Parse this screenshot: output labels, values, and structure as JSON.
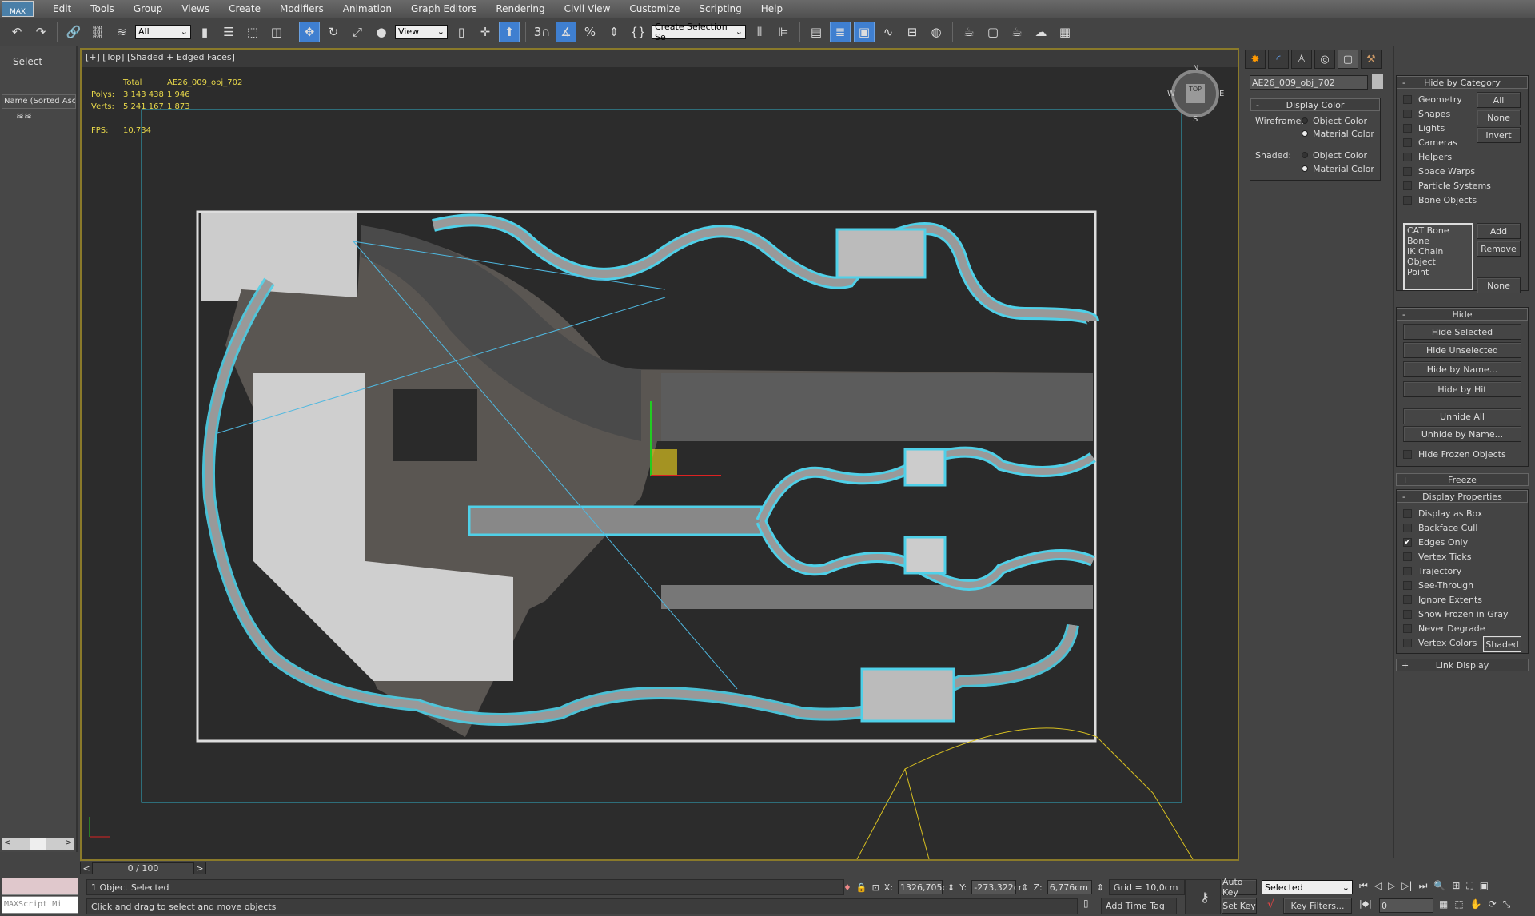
{
  "app": {
    "logo": "MAX"
  },
  "menu": [
    "Edit",
    "Tools",
    "Group",
    "Views",
    "Create",
    "Modifiers",
    "Animation",
    "Graph Editors",
    "Rendering",
    "Civil View",
    "Customize",
    "Scripting",
    "Help"
  ],
  "toolbar": {
    "filter_select": "All",
    "ref_coord_select": "View",
    "named_selection": "Create Selection Se",
    "icons": [
      "undo-icon",
      "redo-icon",
      "link-icon",
      "unlink-icon",
      "bind-space-warp-icon",
      "select-object-icon",
      "select-by-name-icon",
      "rect-selection-icon",
      "window-crossing-icon",
      "select-move-icon",
      "select-rotate-icon",
      "select-scale-icon",
      "select-place-icon",
      "mirror-icon",
      "align-icon",
      "manage-layers-icon",
      "scene-explorer-icon",
      "curve-editor-icon",
      "schematic-view-icon",
      "material-editor-icon",
      "render-setup-icon",
      "rendered-frame-icon",
      "render-icon",
      "render-cloud-icon",
      "a360-gallery-icon"
    ]
  },
  "left_panel": {
    "title": "Select",
    "column_header": "Name (Sorted Asc"
  },
  "viewport": {
    "label": "[+] [Top] [Shaded + Edged Faces]",
    "stats": {
      "col_total": "Total",
      "col_object": "AE26_009_obj_702",
      "polys_label": "Polys:",
      "polys_total": "3 143 438",
      "polys_obj": "1 946",
      "verts_label": "Verts:",
      "verts_total": "5 241 167",
      "verts_obj": "1 873",
      "fps_label": "FPS:",
      "fps": "10,734"
    },
    "viewcube": {
      "face": "TOP",
      "n": "N",
      "s": "S",
      "e": "E",
      "w": "W"
    },
    "colors": {
      "selection": "#4fd0e8",
      "shapes": "#d8c020",
      "safe_frame": "#2fb0c8",
      "background": "#2b2b2b"
    }
  },
  "command_panel": {
    "object_name": "AE26_009_obj_702",
    "display_color": {
      "title": "Display Color",
      "wireframe_label": "Wireframe:",
      "shaded_label": "Shaded:",
      "object_color": "Object Color",
      "material_color": "Material Color",
      "wireframe_selected": "Material Color",
      "shaded_selected": "Material Color"
    },
    "hide_by_category": {
      "title": "Hide by Category",
      "items": [
        "Geometry",
        "Shapes",
        "Lights",
        "Cameras",
        "Helpers",
        "Space Warps",
        "Particle Systems",
        "Bone Objects"
      ],
      "all": "All",
      "none": "None",
      "invert": "Invert",
      "list": [
        "CAT Bone",
        "Bone",
        "IK Chain Object",
        "Point"
      ],
      "add": "Add",
      "remove": "Remove",
      "none2": "None"
    },
    "hide": {
      "title": "Hide",
      "buttons": [
        "Hide Selected",
        "Hide Unselected",
        "Hide by Name...",
        "Hide by Hit",
        "Unhide All",
        "Unhide by Name..."
      ],
      "hide_frozen": "Hide Frozen Objects"
    },
    "freeze": {
      "title": "Freeze"
    },
    "display_properties": {
      "title": "Display Properties",
      "items": [
        {
          "label": "Display as Box",
          "checked": false
        },
        {
          "label": "Backface Cull",
          "checked": false
        },
        {
          "label": "Edges Only",
          "checked": true
        },
        {
          "label": "Vertex Ticks",
          "checked": false
        },
        {
          "label": "Trajectory",
          "checked": false
        },
        {
          "label": "See-Through",
          "checked": false
        },
        {
          "label": "Ignore Extents",
          "checked": false
        },
        {
          "label": "Show Frozen in Gray",
          "checked": false
        },
        {
          "label": "Never Degrade",
          "checked": false
        },
        {
          "label": "Vertex Colors",
          "checked": false
        }
      ],
      "shaded_btn": "Shaded"
    },
    "link_display": {
      "title": "Link Display"
    }
  },
  "timeline": {
    "position": "0 / 100",
    "prev": "<",
    "next": ">"
  },
  "status": {
    "maxscript": "MAXScript Mi",
    "selected": "1 Object Selected",
    "prompt": "Click and drag to select and move objects",
    "x_label": "X:",
    "x": "1326,705c",
    "y_label": "Y:",
    "y": "-273,322cr",
    "z_label": "Z:",
    "z": "6,776cm",
    "grid": "Grid = 10,0cm",
    "add_time_tag": "Add Time Tag",
    "auto_key": "Auto Key",
    "set_key": "Set Key",
    "key_mode": "Selected",
    "key_filters": "Key Filters...",
    "frame": "0"
  }
}
